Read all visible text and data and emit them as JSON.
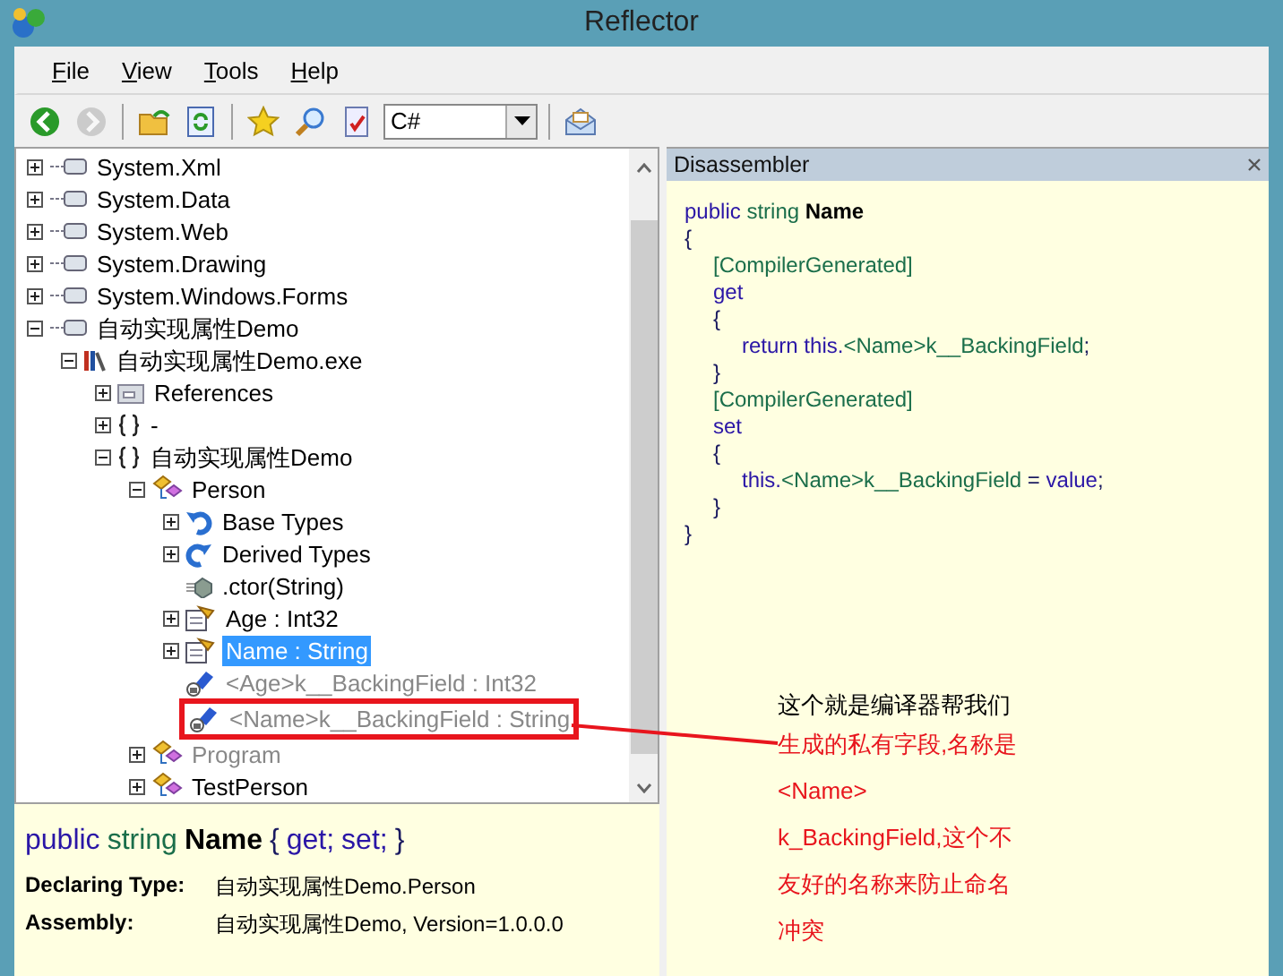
{
  "window": {
    "title": "Reflector"
  },
  "menu": [
    {
      "label": "File"
    },
    {
      "label": "View"
    },
    {
      "label": "Tools"
    },
    {
      "label": "Help"
    }
  ],
  "toolbar": {
    "buttons": [
      {
        "kind": "back",
        "disabled": false
      },
      {
        "kind": "forward",
        "disabled": true
      },
      {
        "kind": "sep"
      },
      {
        "kind": "open"
      },
      {
        "kind": "refresh"
      },
      {
        "kind": "sep"
      },
      {
        "kind": "star"
      },
      {
        "kind": "search"
      },
      {
        "kind": "check"
      }
    ],
    "language": "C#",
    "after": [
      {
        "kind": "sep"
      },
      {
        "kind": "mail"
      }
    ]
  },
  "tree": [
    {
      "label": "System.Xml",
      "kind": "assembly",
      "expanded": false
    },
    {
      "label": "System.Data",
      "kind": "assembly",
      "expanded": false
    },
    {
      "label": "System.Web",
      "kind": "assembly",
      "expanded": false
    },
    {
      "label": "System.Drawing",
      "kind": "assembly",
      "expanded": false
    },
    {
      "label": "System.Windows.Forms",
      "kind": "assembly",
      "expanded": false
    },
    {
      "label": "自动实现属性Demo",
      "kind": "assembly",
      "expanded": true,
      "children": [
        {
          "label": "自动实现属性Demo.exe",
          "kind": "module",
          "expanded": true,
          "children": [
            {
              "label": "References",
              "kind": "references",
              "expanded": false
            },
            {
              "label": "-",
              "kind": "namespace",
              "expanded": false
            },
            {
              "label": "自动实现属性Demo",
              "kind": "namespace",
              "expanded": true,
              "children": [
                {
                  "label": "Person",
                  "kind": "class",
                  "expanded": true,
                  "children": [
                    {
                      "label": "Base Types",
                      "kind": "basetypes",
                      "expanded": false
                    },
                    {
                      "label": "Derived Types",
                      "kind": "derivedtypes",
                      "expanded": false
                    },
                    {
                      "label": ".ctor(String)",
                      "kind": "method"
                    },
                    {
                      "label": "Age : Int32",
                      "kind": "property",
                      "expanded": false,
                      "selected": false
                    },
                    {
                      "label": "Name : String",
                      "kind": "property",
                      "expanded": false,
                      "selected": true
                    },
                    {
                      "label": "<Age>k__BackingField : Int32",
                      "kind": "field",
                      "dimmed": true
                    },
                    {
                      "label": "<Name>k__BackingField : String",
                      "kind": "field",
                      "dimmed": true,
                      "marked": true
                    }
                  ]
                },
                {
                  "label": "Program",
                  "kind": "class",
                  "expanded": false,
                  "dimmed": true
                },
                {
                  "label": "TestPerson",
                  "kind": "class",
                  "expanded": false
                }
              ]
            }
          ]
        }
      ]
    }
  ],
  "info": {
    "signature": [
      {
        "text": "public",
        "kind": "keyword"
      },
      {
        "text": "string",
        "kind": "type"
      },
      {
        "text": "Name",
        "kind": "name"
      },
      {
        "text": "{",
        "kind": "plain"
      },
      {
        "text": "get;",
        "kind": "keyword"
      },
      {
        "text": "set;",
        "kind": "keyword"
      },
      {
        "text": "}",
        "kind": "plain"
      }
    ],
    "rows": [
      {
        "label": "Declaring Type:",
        "value": "自动实现属性Demo.Person"
      },
      {
        "label": "Assembly:",
        "value": "自动实现属性Demo, Version=1.0.0.0"
      }
    ]
  },
  "disassembler": {
    "title": "Disassembler",
    "code": [
      {
        "tokens": [
          {
            "text": "public",
            "kind": "keyword"
          },
          {
            "text": " string",
            "kind": "type"
          },
          {
            "text": " Name",
            "kind": "name"
          }
        ]
      },
      {
        "tokens": [
          {
            "text": "{",
            "kind": "plain"
          }
        ]
      },
      {
        "children": [
          {
            "tokens": [
              {
                "text": "[CompilerGenerated]",
                "kind": "type"
              }
            ]
          },
          {
            "tokens": [
              {
                "text": "get",
                "kind": "keyword"
              }
            ]
          },
          {
            "tokens": [
              {
                "text": "{",
                "kind": "plain"
              }
            ]
          },
          {
            "children": [
              {
                "tokens": [
                  {
                    "text": "return this.",
                    "kind": "keyword"
                  },
                  {
                    "text": "<Name>k__BackingField",
                    "kind": "type"
                  },
                  {
                    "text": ";",
                    "kind": "plain"
                  }
                ]
              }
            ]
          },
          {
            "tokens": [
              {
                "text": "}",
                "kind": "plain"
              }
            ]
          },
          {
            "tokens": [
              {
                "text": "[CompilerGenerated]",
                "kind": "type"
              }
            ]
          },
          {
            "tokens": [
              {
                "text": "set",
                "kind": "keyword"
              }
            ]
          },
          {
            "tokens": [
              {
                "text": "{",
                "kind": "plain"
              }
            ]
          },
          {
            "children": [
              {
                "tokens": [
                  {
                    "text": "this.",
                    "kind": "keyword"
                  },
                  {
                    "text": "<Name>k__BackingField",
                    "kind": "type"
                  },
                  {
                    "text": " = ",
                    "kind": "plain"
                  },
                  {
                    "text": "value",
                    "kind": "keyword"
                  },
                  {
                    "text": ";",
                    "kind": "plain"
                  }
                ]
              }
            ]
          },
          {
            "tokens": [
              {
                "text": "}",
                "kind": "plain"
              }
            ]
          }
        ]
      },
      {
        "tokens": [
          {
            "text": "}",
            "kind": "plain"
          }
        ]
      }
    ]
  },
  "annotation": {
    "lines": [
      {
        "text": "这个就是编译器帮我们",
        "kind": "lead"
      },
      {
        "text": "生成的私有字段,名称是",
        "kind": "emphasis"
      },
      {
        "text": "<Name>",
        "kind": "emphasis"
      },
      {
        "text": "k_BackingField,这个不",
        "kind": "emphasis"
      },
      {
        "text": "友好的名称来防止命名",
        "kind": "emphasis"
      },
      {
        "text": "冲突",
        "kind": "emphasis"
      }
    ]
  }
}
